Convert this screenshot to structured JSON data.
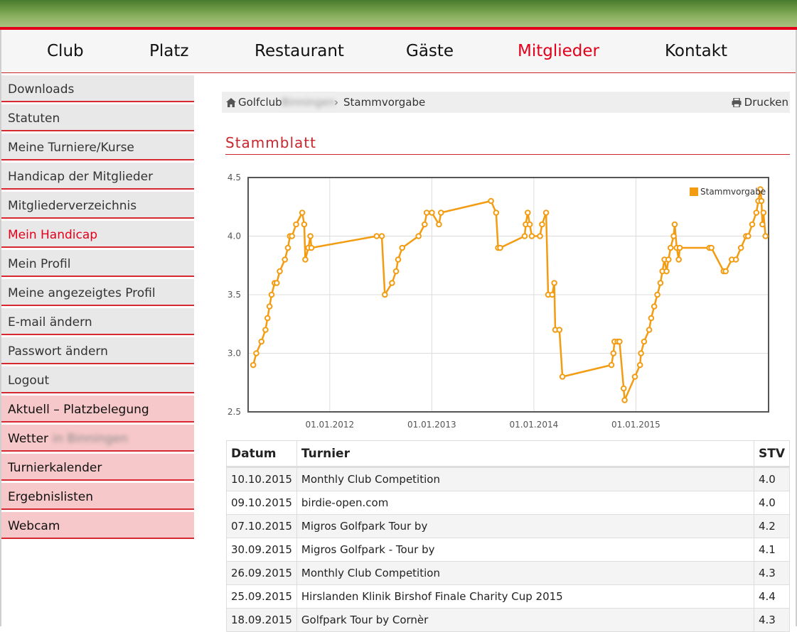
{
  "nav": {
    "items": [
      {
        "label": "Club"
      },
      {
        "label": "Platz"
      },
      {
        "label": "Restaurant"
      },
      {
        "label": "Gäste"
      },
      {
        "label": "Mitglieder",
        "active": true
      },
      {
        "label": "Kontakt"
      }
    ]
  },
  "sidebar": {
    "items": [
      {
        "label": "Downloads"
      },
      {
        "label": "Statuten"
      },
      {
        "label": "Meine Turniere/Kurse"
      },
      {
        "label": "Handicap der Mitglieder"
      },
      {
        "label": "Mitgliederverzeichnis"
      },
      {
        "label": "Mein Handicap",
        "active": true
      },
      {
        "label": "Mein Profil"
      },
      {
        "label": "Meine angezeigtes Profil"
      },
      {
        "label": "E-mail ändern"
      },
      {
        "label": "Passwort ändern"
      },
      {
        "label": "Logout"
      },
      {
        "label": "Aktuell – Platzbelegung",
        "highlight": true
      },
      {
        "label": "Wetter",
        "highlight": true,
        "blurred": "in Binningen"
      },
      {
        "label": "Turnierkalender",
        "highlight": true
      },
      {
        "label": "Ergebnislisten",
        "highlight": true
      },
      {
        "label": "Webcam",
        "highlight": true
      }
    ]
  },
  "breadcrumb": {
    "home": "Golfclub",
    "blurred": "Binningen",
    "separator": "›",
    "current": "Stammvorgabe",
    "print_label": "Drucken"
  },
  "section_title": "Stammblatt",
  "colors": {
    "accent": "#e3001b",
    "line": "#f39c12",
    "pink": "#f7c8c9"
  },
  "chart_data": {
    "type": "line",
    "series": [
      {
        "name": "Stammvorgabe",
        "values": [
          [
            2011.25,
            2.9
          ],
          [
            2011.28,
            3.0
          ],
          [
            2011.33,
            3.1
          ],
          [
            2011.37,
            3.2
          ],
          [
            2011.39,
            3.3
          ],
          [
            2011.41,
            3.4
          ],
          [
            2011.43,
            3.5
          ],
          [
            2011.46,
            3.6
          ],
          [
            2011.48,
            3.6
          ],
          [
            2011.51,
            3.7
          ],
          [
            2011.56,
            3.8
          ],
          [
            2011.59,
            3.9
          ],
          [
            2011.61,
            4.0
          ],
          [
            2011.63,
            4.0
          ],
          [
            2011.67,
            4.1
          ],
          [
            2011.73,
            4.2
          ],
          [
            2011.75,
            4.1
          ],
          [
            2011.76,
            3.8
          ],
          [
            2011.79,
            3.9
          ],
          [
            2011.81,
            4.0
          ],
          [
            2011.82,
            3.9
          ],
          [
            2012.46,
            4.0
          ],
          [
            2012.51,
            4.0
          ],
          [
            2012.54,
            3.5
          ],
          [
            2012.61,
            3.6
          ],
          [
            2012.65,
            3.7
          ],
          [
            2012.67,
            3.8
          ],
          [
            2012.71,
            3.9
          ],
          [
            2012.87,
            4.0
          ],
          [
            2012.93,
            4.1
          ],
          [
            2012.95,
            4.2
          ],
          [
            2013.0,
            4.2
          ],
          [
            2013.07,
            4.1
          ],
          [
            2013.09,
            4.2
          ],
          [
            2013.58,
            4.3
          ],
          [
            2013.63,
            4.2
          ],
          [
            2013.65,
            3.9
          ],
          [
            2013.67,
            3.9
          ],
          [
            2013.91,
            4.0
          ],
          [
            2013.92,
            4.1
          ],
          [
            2013.94,
            4.2
          ],
          [
            2013.96,
            4.1
          ],
          [
            2013.98,
            4.0
          ],
          [
            2014.06,
            4.0
          ],
          [
            2014.08,
            4.1
          ],
          [
            2014.12,
            4.2
          ],
          [
            2014.14,
            3.5
          ],
          [
            2014.18,
            3.5
          ],
          [
            2014.2,
            3.6
          ],
          [
            2014.21,
            3.2
          ],
          [
            2014.25,
            3.2
          ],
          [
            2014.28,
            2.8
          ],
          [
            2014.76,
            2.9
          ],
          [
            2014.78,
            3.0
          ],
          [
            2014.79,
            3.1
          ],
          [
            2014.82,
            3.1
          ],
          [
            2014.84,
            3.1
          ],
          [
            2014.88,
            2.7
          ],
          [
            2014.89,
            2.6
          ],
          [
            2014.99,
            2.8
          ],
          [
            2015.04,
            2.9
          ],
          [
            2015.05,
            3.0
          ],
          [
            2015.08,
            3.1
          ],
          [
            2015.13,
            3.2
          ],
          [
            2015.15,
            3.3
          ],
          [
            2015.18,
            3.4
          ],
          [
            2015.21,
            3.5
          ],
          [
            2015.24,
            3.6
          ],
          [
            2015.26,
            3.7
          ],
          [
            2015.28,
            3.8
          ],
          [
            2015.3,
            3.7
          ],
          [
            2015.32,
            3.8
          ],
          [
            2015.34,
            3.9
          ],
          [
            2015.37,
            4.0
          ],
          [
            2015.38,
            4.1
          ],
          [
            2015.4,
            3.9
          ],
          [
            2015.42,
            3.8
          ],
          [
            2015.43,
            3.9
          ],
          [
            2015.72,
            3.9
          ],
          [
            2015.74,
            3.9
          ],
          [
            2015.86,
            3.7
          ],
          [
            2015.88,
            3.7
          ],
          [
            2015.94,
            3.8
          ],
          [
            2015.98,
            3.8
          ],
          [
            2016.03,
            3.9
          ],
          [
            2016.08,
            4.0
          ],
          [
            2016.1,
            4.0
          ],
          [
            2016.14,
            4.1
          ],
          [
            2016.18,
            4.2
          ],
          [
            2016.2,
            4.3
          ],
          [
            2016.22,
            4.4
          ],
          [
            2016.23,
            4.3
          ],
          [
            2016.24,
            4.1
          ],
          [
            2016.25,
            4.2
          ],
          [
            2016.27,
            4.0
          ]
        ]
      }
    ],
    "xticks": [
      "01.01.2012",
      "01.01.2013",
      "01.01.2014",
      "01.01.2015"
    ],
    "ylim": [
      2.5,
      4.5
    ],
    "yticks": [
      "2.5",
      "3.0",
      "3.5",
      "4.0",
      "4.5"
    ],
    "legend_position": "top-right",
    "grid": true
  },
  "table": {
    "headers": [
      "Datum",
      "Turnier",
      "STV"
    ],
    "rows": [
      [
        "10.10.2015",
        "Monthly Club Competition",
        "4.0"
      ],
      [
        "09.10.2015",
        "birdie-open.com",
        "4.0"
      ],
      [
        "07.10.2015",
        "Migros Golfpark Tour by",
        "4.2"
      ],
      [
        "30.09.2015",
        "Migros Golfpark - Tour by",
        "4.1"
      ],
      [
        "26.09.2015",
        "Monthly Club Competition",
        "4.3"
      ],
      [
        "25.09.2015",
        "Hirslanden Klinik Birshof Finale Charity Cup 2015",
        "4.4"
      ],
      [
        "18.09.2015",
        "Golfpark Tour by Cornèr",
        "4.3"
      ]
    ]
  }
}
